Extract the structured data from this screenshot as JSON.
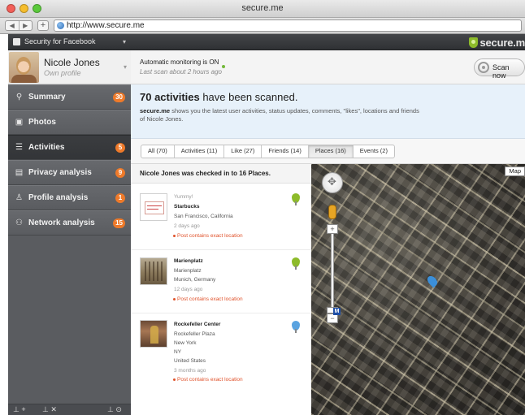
{
  "window": {
    "title": "secure.me",
    "url": "http://www.secure.me"
  },
  "app": {
    "title": "Security for Facebook",
    "brand": "secure.m"
  },
  "profile": {
    "name": "Nicole Jones",
    "subtitle": "Own profile"
  },
  "nav": [
    {
      "label": "Summary",
      "badge": "30",
      "icon": "magnifier-icon"
    },
    {
      "label": "Photos",
      "badge": "",
      "icon": "photo-icon"
    },
    {
      "label": "Activities",
      "badge": "5",
      "icon": "activity-icon",
      "active": true
    },
    {
      "label": "Privacy analysis",
      "badge": "9",
      "icon": "privacy-icon"
    },
    {
      "label": "Profile analysis",
      "badge": "1",
      "icon": "profile-icon"
    },
    {
      "label": "Network analysis",
      "badge": "15",
      "icon": "network-icon"
    }
  ],
  "monitoring": {
    "status": "Automatic monitoring is ON",
    "last_scan": "Last scan about 2 hours ago",
    "scan_button": "Scan now"
  },
  "banner": {
    "count": "70 activities",
    "heading_rest": " have been scanned.",
    "brand": "secure.me",
    "description": " shows you the latest user activities, status updates, comments, \"likes\", locations and friends of Nicole Jones."
  },
  "tabs": [
    {
      "label": "All (70)"
    },
    {
      "label": "Activities (11)"
    },
    {
      "label": "Like (27)"
    },
    {
      "label": "Friends (14)"
    },
    {
      "label": "Places (16)",
      "active": true
    },
    {
      "label": "Events (2)"
    }
  ],
  "places": {
    "header": "Nicole Jones was checked in to 16 Places.",
    "items": [
      {
        "comment": "Yummy!",
        "name": "Starbucks",
        "line1": "San Francisco, California",
        "time": "2 days ago",
        "alert": "Post contains exact location",
        "pin_color": "#8dbb2a"
      },
      {
        "name": "Marienplatz",
        "line1": "Marienplatz",
        "line2": "Munich, Germany",
        "time": "12 days ago",
        "alert": "Post contains exact location",
        "pin_color": "#8dbb2a"
      },
      {
        "name": "Rockefeller Center",
        "line1": "Rockefeller Plaza",
        "line2": "New York",
        "line3": "NY",
        "line4": "United States",
        "time": "3 months ago",
        "alert": "Post contains exact location",
        "pin_color": "#5aa3e0"
      }
    ]
  },
  "map": {
    "type_button": "Map",
    "zoom_in": "+",
    "zoom_out": "−",
    "subway_marker": "M"
  },
  "footer": {
    "add_friend": "⊥ +",
    "remove_friend": "⊥ ✕",
    "lock": "⊥ ⊙"
  },
  "colors": {
    "accent_orange": "#ee7a2a",
    "brand_green": "#8dbb2a",
    "alert_red": "#e0522b",
    "banner_blue": "#e7f1fa"
  }
}
